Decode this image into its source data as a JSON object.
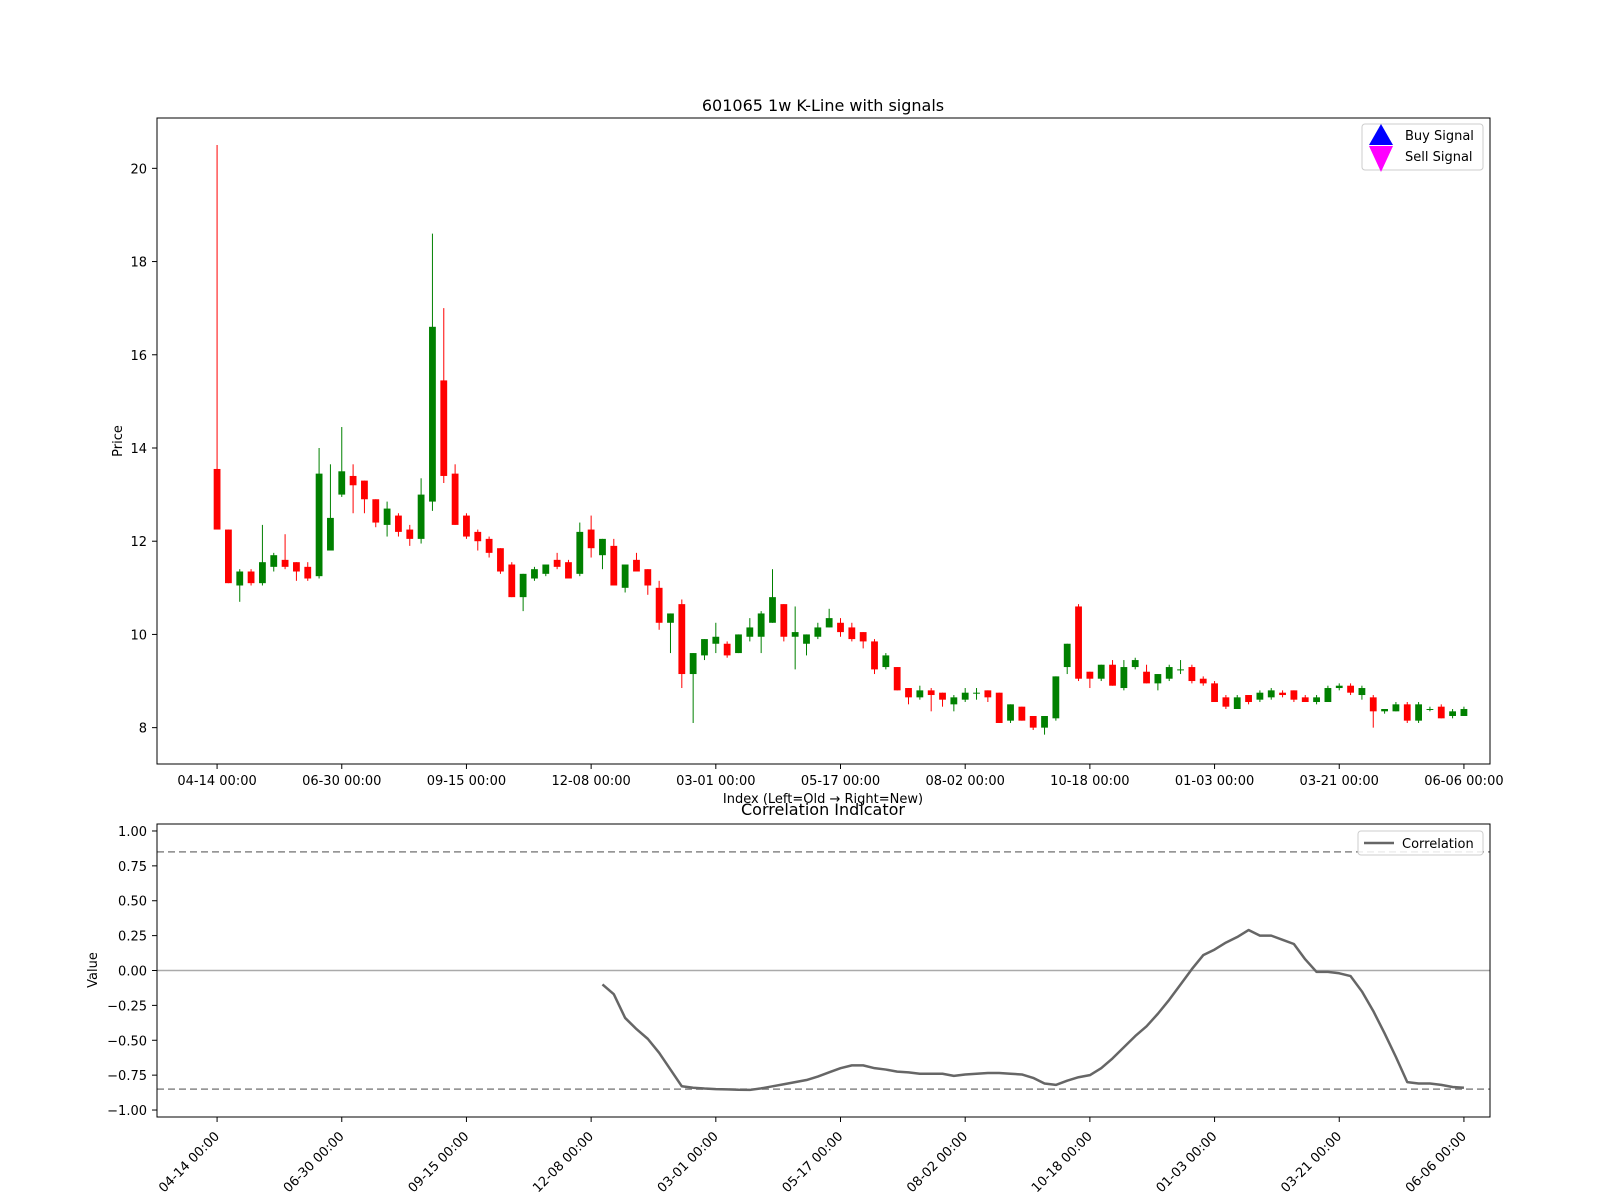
{
  "chart_data": [
    {
      "type": "candlestick",
      "title": "601065 1w K-Line with signals",
      "xlabel": "Index (Left=Old → Right=New)",
      "ylabel": "Price",
      "xlim": [
        -5.3,
        112.3
      ],
      "ylim": [
        7.22,
        21.08
      ],
      "yticks": [
        8,
        10,
        12,
        14,
        16,
        18,
        20
      ],
      "xticks": [
        {
          "index": 0,
          "label": "04-14 00:00"
        },
        {
          "index": 11,
          "label": "06-30 00:00"
        },
        {
          "index": 22,
          "label": "09-15 00:00"
        },
        {
          "index": 33,
          "label": "12-08 00:00"
        },
        {
          "index": 44,
          "label": "03-01 00:00"
        },
        {
          "index": 55,
          "label": "05-17 00:00"
        },
        {
          "index": 66,
          "label": "08-02 00:00"
        },
        {
          "index": 77,
          "label": "10-18 00:00"
        },
        {
          "index": 88,
          "label": "01-03 00:00"
        },
        {
          "index": 99,
          "label": "03-21 00:00"
        },
        {
          "index": 110,
          "label": "06-06 00:00"
        }
      ],
      "up_color": "#008000",
      "down_color": "#ff0000",
      "candles": [
        [
          13.55,
          12.25,
          20.5,
          12.25
        ],
        [
          12.25,
          11.1,
          12.25,
          11.1
        ],
        [
          11.05,
          11.35,
          11.4,
          10.7
        ],
        [
          11.35,
          11.1,
          11.4,
          11.05
        ],
        [
          11.1,
          11.55,
          12.35,
          11.05
        ],
        [
          11.45,
          11.7,
          11.75,
          11.35
        ],
        [
          11.6,
          11.45,
          12.15,
          11.4
        ],
        [
          11.55,
          11.35,
          11.55,
          11.15
        ],
        [
          11.45,
          11.2,
          11.55,
          11.15
        ],
        [
          11.25,
          13.45,
          14.0,
          11.2
        ],
        [
          11.8,
          12.5,
          13.65,
          12.3
        ],
        [
          13.0,
          13.5,
          14.45,
          12.95
        ],
        [
          13.4,
          13.2,
          13.65,
          12.6
        ],
        [
          13.3,
          12.9,
          13.3,
          12.6
        ],
        [
          12.9,
          12.4,
          12.9,
          12.3
        ],
        [
          12.35,
          12.7,
          12.85,
          12.1
        ],
        [
          12.55,
          12.2,
          12.6,
          12.1
        ],
        [
          12.25,
          12.05,
          12.35,
          11.9
        ],
        [
          12.05,
          13.0,
          13.35,
          11.95
        ],
        [
          12.85,
          16.6,
          18.6,
          12.65
        ],
        [
          15.45,
          13.4,
          17.0,
          13.25
        ],
        [
          13.45,
          12.35,
          13.65,
          12.35
        ],
        [
          12.55,
          12.1,
          12.6,
          12.05
        ],
        [
          12.2,
          12.0,
          12.25,
          11.8
        ],
        [
          12.05,
          11.75,
          12.1,
          11.65
        ],
        [
          11.85,
          11.35,
          11.85,
          11.3
        ],
        [
          11.5,
          10.8,
          11.55,
          10.8
        ],
        [
          10.8,
          11.3,
          11.3,
          10.5
        ],
        [
          11.2,
          11.4,
          11.45,
          11.15
        ],
        [
          11.3,
          11.5,
          11.5,
          11.25
        ],
        [
          11.6,
          11.45,
          11.75,
          11.4
        ],
        [
          11.55,
          11.2,
          11.6,
          11.2
        ],
        [
          11.3,
          12.2,
          12.4,
          11.25
        ],
        [
          12.25,
          11.85,
          12.55,
          11.65
        ],
        [
          11.7,
          12.05,
          12.05,
          11.4
        ],
        [
          11.9,
          11.05,
          12.05,
          11.05
        ],
        [
          11.0,
          11.5,
          11.5,
          10.9
        ],
        [
          11.6,
          11.35,
          11.75,
          11.35
        ],
        [
          11.4,
          11.05,
          11.4,
          10.85
        ],
        [
          11.0,
          10.25,
          11.15,
          10.1
        ],
        [
          10.25,
          10.45,
          10.45,
          9.6
        ],
        [
          10.65,
          9.15,
          10.75,
          8.85
        ],
        [
          9.15,
          9.6,
          9.6,
          8.1
        ],
        [
          9.55,
          9.9,
          9.9,
          9.45
        ],
        [
          9.8,
          9.95,
          10.25,
          9.6
        ],
        [
          9.8,
          9.55,
          9.85,
          9.5
        ],
        [
          9.6,
          10.0,
          10.0,
          9.6
        ],
        [
          9.95,
          10.15,
          10.35,
          9.85
        ],
        [
          9.95,
          10.45,
          10.5,
          9.6
        ],
        [
          10.25,
          10.8,
          11.4,
          10.25
        ],
        [
          10.65,
          9.95,
          10.65,
          9.85
        ],
        [
          9.95,
          10.05,
          10.6,
          9.25
        ],
        [
          9.8,
          10.0,
          10.0,
          9.55
        ],
        [
          9.95,
          10.15,
          10.25,
          9.9
        ],
        [
          10.15,
          10.35,
          10.55,
          10.15
        ],
        [
          10.25,
          10.05,
          10.35,
          9.95
        ],
        [
          10.15,
          9.9,
          10.25,
          9.85
        ],
        [
          10.05,
          9.85,
          10.05,
          9.7
        ],
        [
          9.85,
          9.25,
          9.9,
          9.15
        ],
        [
          9.3,
          9.55,
          9.6,
          9.25
        ],
        [
          9.3,
          8.8,
          9.3,
          8.8
        ],
        [
          8.85,
          8.65,
          8.85,
          8.5
        ],
        [
          8.65,
          8.8,
          8.9,
          8.6
        ],
        [
          8.8,
          8.7,
          8.85,
          8.35
        ],
        [
          8.75,
          8.6,
          8.75,
          8.45
        ],
        [
          8.5,
          8.65,
          8.7,
          8.35
        ],
        [
          8.6,
          8.75,
          8.85,
          8.55
        ],
        [
          8.75,
          8.75,
          8.85,
          8.6
        ],
        [
          8.8,
          8.65,
          8.8,
          8.55
        ],
        [
          8.75,
          8.1,
          8.75,
          8.1
        ],
        [
          8.15,
          8.5,
          8.5,
          8.1
        ],
        [
          8.45,
          8.15,
          8.45,
          8.15
        ],
        [
          8.25,
          8.0,
          8.25,
          7.95
        ],
        [
          8.0,
          8.25,
          8.25,
          7.85
        ],
        [
          8.2,
          9.1,
          9.1,
          8.15
        ],
        [
          9.3,
          9.8,
          9.8,
          9.15
        ],
        [
          10.6,
          9.05,
          10.65,
          9.0
        ],
        [
          9.2,
          9.05,
          9.2,
          8.85
        ],
        [
          9.05,
          9.35,
          9.35,
          9.0
        ],
        [
          9.35,
          8.9,
          9.45,
          8.9
        ],
        [
          8.85,
          9.3,
          9.45,
          8.8
        ],
        [
          9.3,
          9.45,
          9.5,
          9.25
        ],
        [
          9.2,
          8.95,
          9.35,
          8.95
        ],
        [
          8.95,
          9.15,
          9.15,
          8.8
        ],
        [
          9.05,
          9.3,
          9.35,
          9.0
        ],
        [
          9.25,
          9.25,
          9.45,
          9.15
        ],
        [
          9.3,
          9.0,
          9.35,
          8.95
        ],
        [
          9.05,
          8.95,
          9.1,
          8.9
        ],
        [
          8.95,
          8.55,
          9.0,
          8.55
        ],
        [
          8.65,
          8.45,
          8.7,
          8.4
        ],
        [
          8.4,
          8.65,
          8.7,
          8.4
        ],
        [
          8.7,
          8.55,
          8.7,
          8.5
        ],
        [
          8.6,
          8.75,
          8.8,
          8.55
        ],
        [
          8.65,
          8.8,
          8.85,
          8.6
        ],
        [
          8.75,
          8.7,
          8.8,
          8.65
        ],
        [
          8.8,
          8.6,
          8.8,
          8.55
        ],
        [
          8.65,
          8.55,
          8.7,
          8.55
        ],
        [
          8.55,
          8.65,
          8.7,
          8.5
        ],
        [
          8.55,
          8.85,
          8.9,
          8.55
        ],
        [
          8.85,
          8.9,
          8.95,
          8.8
        ],
        [
          8.9,
          8.75,
          8.95,
          8.7
        ],
        [
          8.7,
          8.85,
          8.9,
          8.6
        ],
        [
          8.65,
          8.35,
          8.7,
          8.0
        ],
        [
          8.35,
          8.4,
          8.4,
          8.3
        ],
        [
          8.35,
          8.5,
          8.55,
          8.35
        ],
        [
          8.5,
          8.15,
          8.55,
          8.1
        ],
        [
          8.15,
          8.5,
          8.55,
          8.1
        ],
        [
          8.4,
          8.4,
          8.45,
          8.35
        ],
        [
          8.45,
          8.2,
          8.5,
          8.2
        ],
        [
          8.25,
          8.35,
          8.4,
          8.2
        ],
        [
          8.25,
          8.4,
          8.45,
          8.25
        ]
      ],
      "legend": [
        {
          "label": "Buy Signal",
          "marker": "triangle-up",
          "color": "#0000ff"
        },
        {
          "label": "Sell Signal",
          "marker": "triangle-down",
          "color": "#ff00ff"
        }
      ],
      "legend_position": "upper right"
    },
    {
      "type": "line",
      "title": "Correlation Indicator",
      "ylabel": "Value",
      "xlim": [
        -5.3,
        112.3
      ],
      "ylim": [
        -1.05,
        1.05
      ],
      "yticks": [
        1.0,
        0.75,
        0.5,
        0.25,
        0.0,
        -0.25,
        -0.5,
        -0.75,
        -1.0
      ],
      "ytick_labels": [
        "1.00",
        "0.75",
        "0.50",
        "0.25",
        "0.00",
        "−0.25",
        "−0.50",
        "−0.75",
        "−1.00"
      ],
      "xticks": [
        {
          "index": 0,
          "label": "04-14 00:00"
        },
        {
          "index": 11,
          "label": "06-30 00:00"
        },
        {
          "index": 22,
          "label": "09-15 00:00"
        },
        {
          "index": 33,
          "label": "12-08 00:00"
        },
        {
          "index": 44,
          "label": "03-01 00:00"
        },
        {
          "index": 55,
          "label": "05-17 00:00"
        },
        {
          "index": 66,
          "label": "08-02 00:00"
        },
        {
          "index": 77,
          "label": "10-18 00:00"
        },
        {
          "index": 88,
          "label": "01-03 00:00"
        },
        {
          "index": 99,
          "label": "03-21 00:00"
        },
        {
          "index": 110,
          "label": "06-06 00:00"
        }
      ],
      "hlines": [
        {
          "y": 0.85,
          "style": "dashed",
          "color": "#888888"
        },
        {
          "y": 0.0,
          "style": "solid",
          "color": "#aaaaaa"
        },
        {
          "y": -0.85,
          "style": "dashed",
          "color": "#888888"
        }
      ],
      "series": [
        {
          "name": "Correlation",
          "color": "#666666",
          "x": [
            34,
            35,
            36,
            37,
            38,
            39,
            40,
            41,
            42,
            43,
            44,
            45,
            46,
            47,
            48,
            49,
            50,
            51,
            52,
            53,
            54,
            55,
            56,
            57,
            58,
            59,
            60,
            61,
            62,
            63,
            64,
            65,
            66,
            67,
            68,
            69,
            70,
            71,
            72,
            73,
            74,
            75,
            76,
            77,
            78,
            79,
            80,
            81,
            82,
            83,
            84,
            85,
            86,
            87,
            88,
            89,
            90,
            91,
            92,
            93,
            94,
            95,
            96,
            97,
            98,
            99,
            100,
            101,
            102,
            103,
            104,
            105,
            106,
            107,
            108,
            109,
            110
          ],
          "values": [
            -0.1,
            -0.17,
            -0.34,
            -0.42,
            -0.49,
            -0.59,
            -0.71,
            -0.83,
            -0.84,
            -0.846,
            -0.85,
            -0.852,
            -0.855,
            -0.856,
            -0.845,
            -0.83,
            -0.815,
            -0.8,
            -0.785,
            -0.76,
            -0.73,
            -0.7,
            -0.68,
            -0.68,
            -0.7,
            -0.71,
            -0.725,
            -0.73,
            -0.74,
            -0.74,
            -0.74,
            -0.755,
            -0.745,
            -0.74,
            -0.735,
            -0.735,
            -0.74,
            -0.745,
            -0.77,
            -0.81,
            -0.82,
            -0.79,
            -0.765,
            -0.75,
            -0.7,
            -0.63,
            -0.55,
            -0.47,
            -0.4,
            -0.31,
            -0.21,
            -0.1,
            0.01,
            0.11,
            0.15,
            0.2,
            0.24,
            0.29,
            0.25,
            0.25,
            0.22,
            0.19,
            0.08,
            -0.01,
            -0.01,
            -0.02,
            -0.04,
            -0.15,
            -0.29,
            -0.45,
            -0.62,
            -0.8,
            -0.81,
            -0.81,
            -0.82,
            -0.835,
            -0.84
          ]
        }
      ],
      "legend": [
        {
          "label": "Correlation",
          "marker": "line",
          "color": "#666666"
        }
      ],
      "legend_position": "upper right"
    }
  ]
}
